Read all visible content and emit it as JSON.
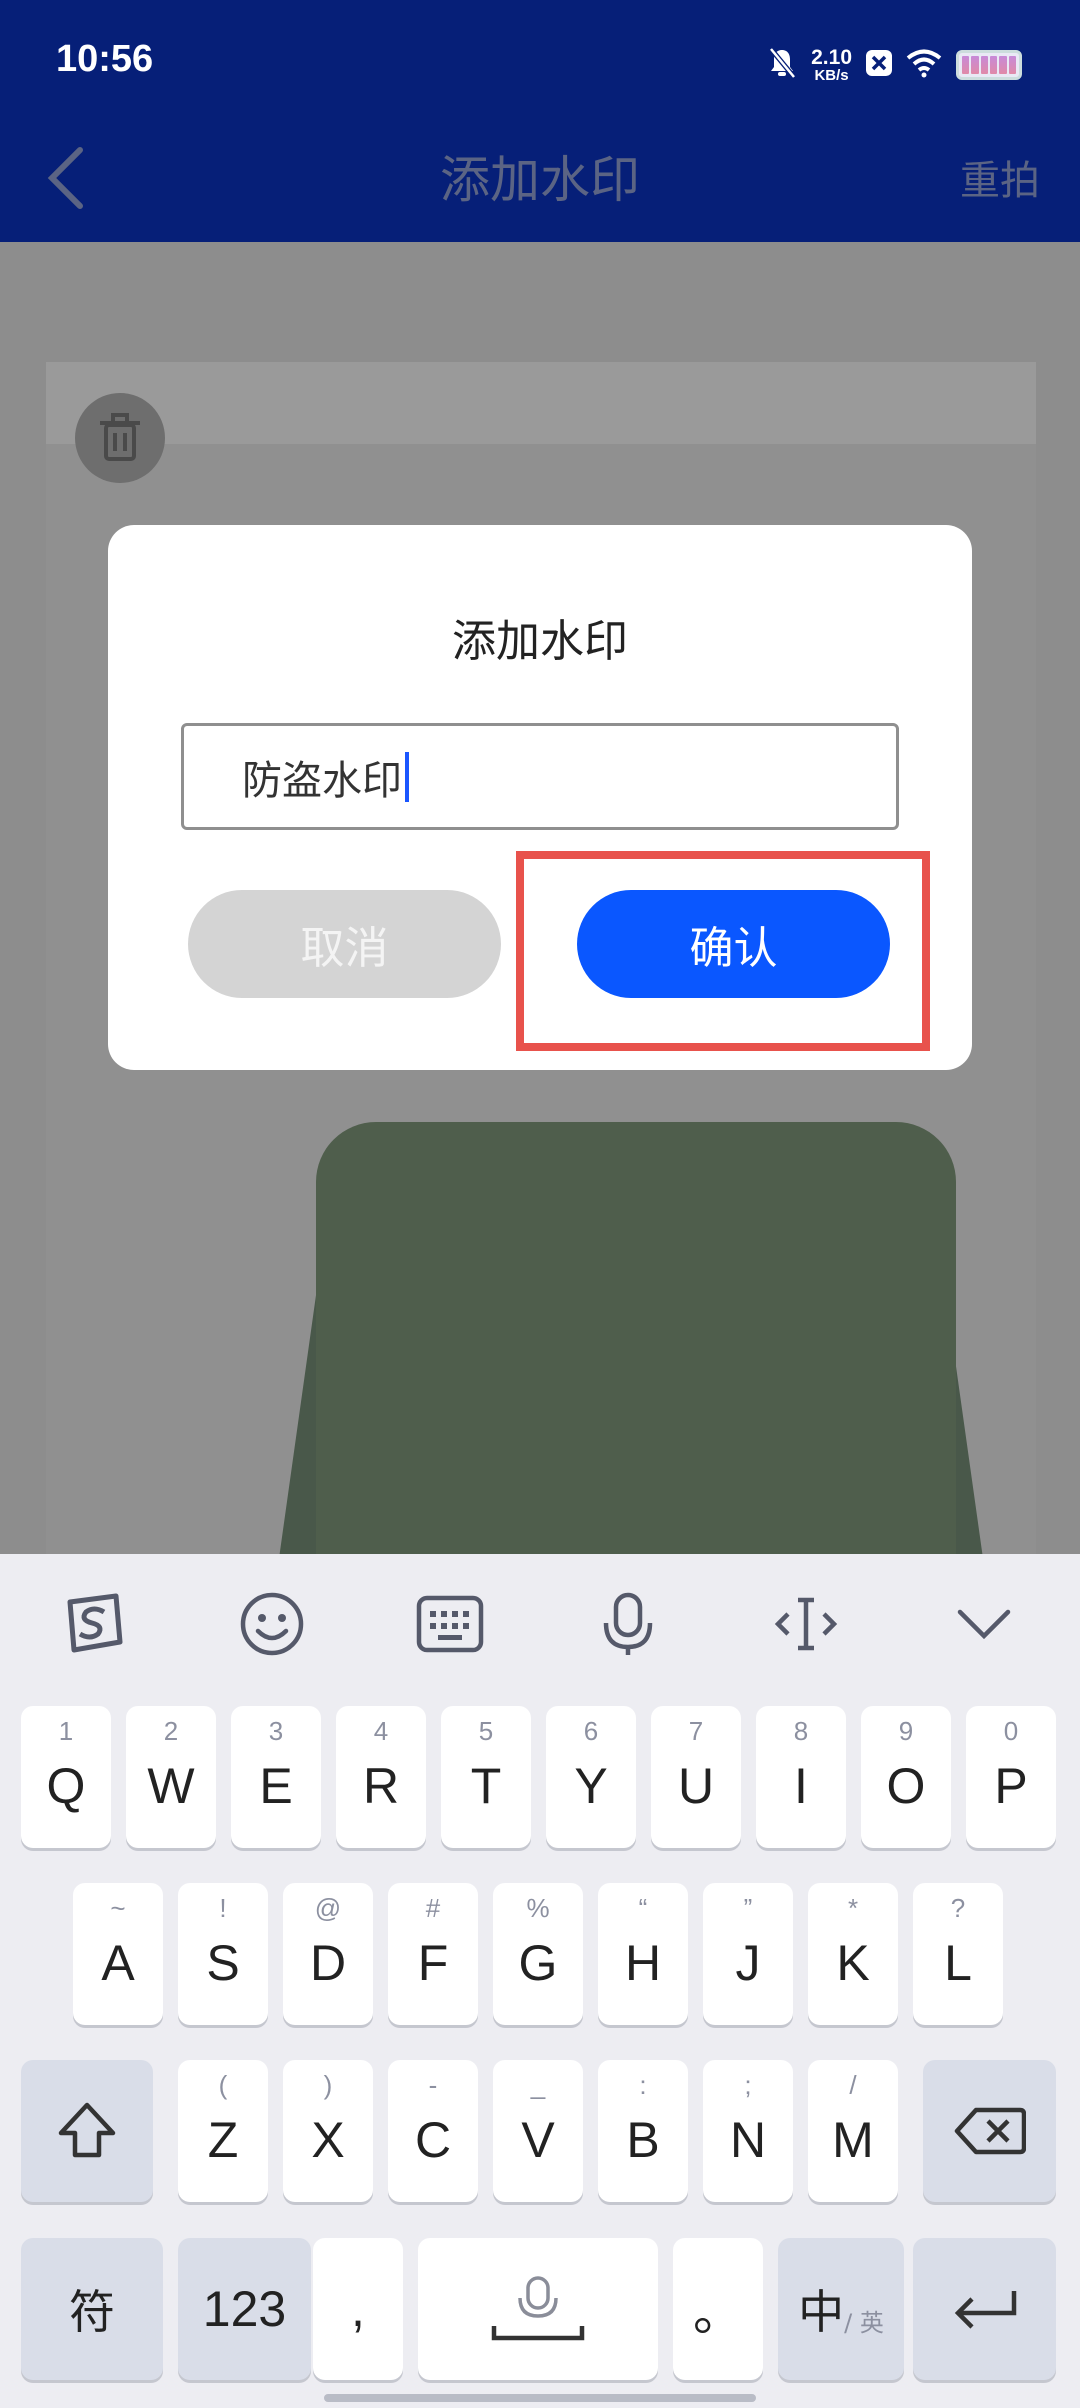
{
  "status_bar": {
    "time": "10:56",
    "net_speed_value": "2.10",
    "net_speed_unit": "KB/s",
    "icons": [
      "bell-off-icon",
      "x-app-icon",
      "wifi-icon",
      "battery-icon"
    ]
  },
  "app_bar": {
    "back_icon": "chevron-left-icon",
    "title": "添加水印",
    "retake_label": "重拍"
  },
  "photo": {
    "delete_icon": "trash-icon"
  },
  "dialog": {
    "title": "添加水印",
    "input_value": "防盗水印",
    "cancel_label": "取消",
    "confirm_label": "确认"
  },
  "colors": {
    "app_bar_bg": "#061f78",
    "confirm_button": "#0a57ff",
    "highlight_border": "#e8524c"
  },
  "keyboard": {
    "toolbar_icons": [
      "sogou-logo-icon",
      "emoji-icon",
      "keyboard-icon",
      "microphone-icon",
      "cursor-move-icon",
      "collapse-chevron-icon"
    ],
    "row1": [
      {
        "main": "Q",
        "hint": "1"
      },
      {
        "main": "W",
        "hint": "2"
      },
      {
        "main": "E",
        "hint": "3"
      },
      {
        "main": "R",
        "hint": "4"
      },
      {
        "main": "T",
        "hint": "5"
      },
      {
        "main": "Y",
        "hint": "6"
      },
      {
        "main": "U",
        "hint": "7"
      },
      {
        "main": "I",
        "hint": "8"
      },
      {
        "main": "O",
        "hint": "9"
      },
      {
        "main": "P",
        "hint": "0"
      }
    ],
    "row2": [
      {
        "main": "A",
        "hint": "~"
      },
      {
        "main": "S",
        "hint": "!"
      },
      {
        "main": "D",
        "hint": "@"
      },
      {
        "main": "F",
        "hint": "#"
      },
      {
        "main": "G",
        "hint": "%"
      },
      {
        "main": "H",
        "hint": "“"
      },
      {
        "main": "J",
        "hint": "”"
      },
      {
        "main": "K",
        "hint": "*"
      },
      {
        "main": "L",
        "hint": "?"
      }
    ],
    "row3": [
      {
        "main": "Z",
        "hint": "("
      },
      {
        "main": "X",
        "hint": ")"
      },
      {
        "main": "C",
        "hint": "-"
      },
      {
        "main": "V",
        "hint": "_"
      },
      {
        "main": "B",
        "hint": ":"
      },
      {
        "main": "N",
        "hint": ";"
      },
      {
        "main": "M",
        "hint": "/"
      }
    ],
    "shift_icon": "shift-arrow-icon",
    "backspace_icon": "backspace-icon",
    "symbol_label": "符",
    "numeric_label": "123",
    "comma_label": ",",
    "space_icon": "space-mic-icon",
    "period_label": "。",
    "lang_main": "中",
    "lang_sub": "/ 英",
    "enter_icon": "enter-icon"
  }
}
